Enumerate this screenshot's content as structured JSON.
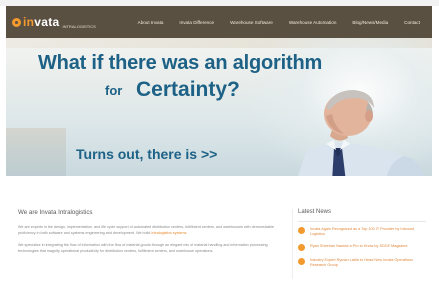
{
  "header": {
    "logo_text_1": "in",
    "logo_text_2": "vata",
    "logo_tag": "INTRALOGISTICS",
    "nav": [
      "About Invata",
      "Invata Difference",
      "Warehouse Software",
      "Warehouse Automation",
      "Blog/News/Media",
      "Contact"
    ]
  },
  "banner": {
    "headline": "What if there was an algorithm",
    "subhead_prefix": "for",
    "subhead_main": "Certainty?",
    "tagline": "Turns out, there is >>"
  },
  "main": {
    "title": "We are Invata Intralogistics",
    "paragraph_1": "We are experts in the design, implementation, and life cycle support of automated distribution centers, fulfillment centers, and warehouses with demonstrable proficiency in both software and systems engineering and development. We build",
    "paragraph_1_link": "Intralogistics systems",
    "paragraph_2": "We specialize in integrating the flow of information with the flow of material goods through an elegant mix of material handling and information processing technologies that magnify operational productivity for distribution centers, fulfillment centers, and warehouse operations."
  },
  "news": {
    "title": "Latest News",
    "items": [
      "Invata Again Recognized as a Top 100 IT Provider by Inbound Logistics",
      "Ryan Sheehan Named a Pro to Know by SDCE Magazine",
      "Industry Expert Ryman Labib to Head New Invata Operations Research Group"
    ]
  },
  "colors": {
    "header_bg": "#5a5042",
    "accent": "#f29a2e",
    "headline_blue": "#1d6286"
  }
}
